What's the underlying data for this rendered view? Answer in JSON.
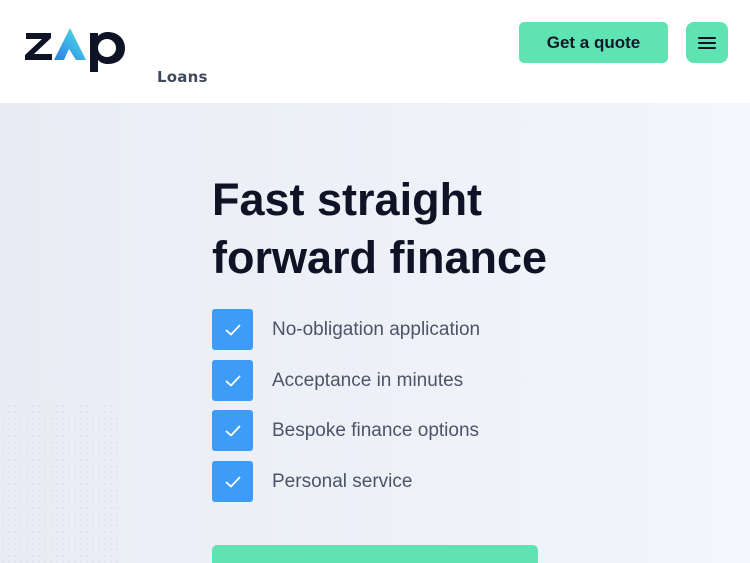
{
  "header": {
    "logo_text": "zap",
    "logo_sub": "Loans",
    "quote_label": "Get a quote",
    "menu_icon": "hamburger-menu-icon"
  },
  "hero": {
    "title_line1": "Fast straight",
    "title_line2": "forward finance",
    "features": [
      {
        "label": "No-obligation application",
        "icon": "check-icon"
      },
      {
        "label": "Acceptance in minutes",
        "icon": "check-icon"
      },
      {
        "label": "Bespoke finance options",
        "icon": "check-icon"
      },
      {
        "label": "Personal service",
        "icon": "check-icon"
      }
    ]
  },
  "colors": {
    "accent_green": "#5fe3b2",
    "check_blue": "#3d9cf5",
    "heading": "#0e1326",
    "text": "#4b5568",
    "hero_bg": "#eef1f8"
  }
}
